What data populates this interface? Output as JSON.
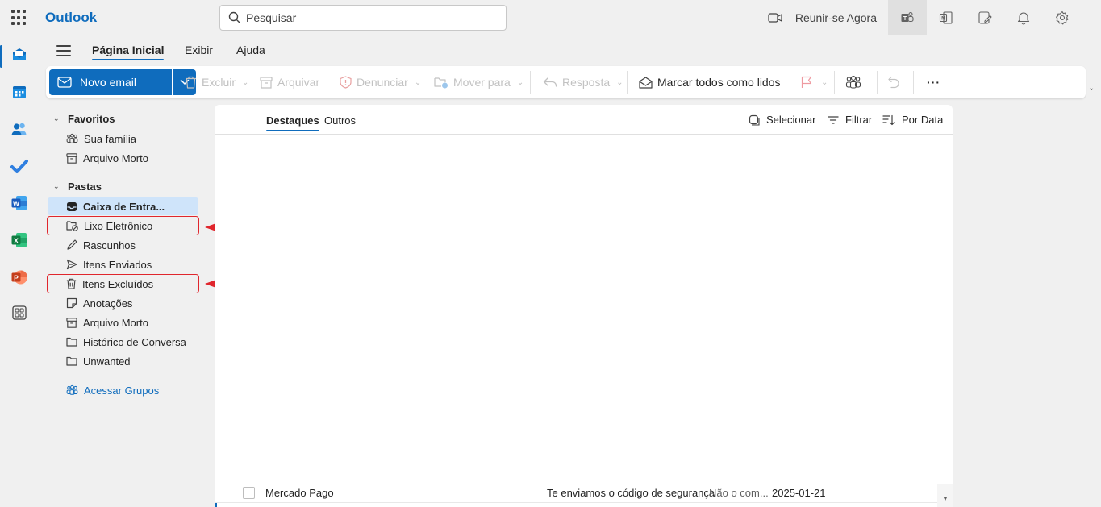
{
  "app": {
    "brand": "Outlook"
  },
  "search": {
    "placeholder": "Pesquisar"
  },
  "topbar": {
    "meet_now": "Reunir-se Agora"
  },
  "nav_tabs": [
    {
      "label": "Página Inicial",
      "selected": true
    },
    {
      "label": "Exibir",
      "selected": false
    },
    {
      "label": "Ajuda",
      "selected": false
    }
  ],
  "ribbon": {
    "new_email": "Novo email",
    "delete": "Excluir",
    "archive": "Arquivar",
    "report": "Denunciar",
    "move_to": "Mover para",
    "reply": "Resposta",
    "mark_all_read": "Marcar todos como lidos",
    "more": "···"
  },
  "folders": {
    "favorites_header": "Favoritos",
    "favorites": [
      {
        "label": "Sua família",
        "icon": "people-group-icon"
      },
      {
        "label": "Arquivo Morto",
        "icon": "archive-icon"
      }
    ],
    "folders_header": "Pastas",
    "items": [
      {
        "label": "Caixa de Entra...",
        "icon": "inbox-icon",
        "selected": true
      },
      {
        "label": "Lixo Eletrônico",
        "icon": "junk-icon",
        "highlighted": true
      },
      {
        "label": "Rascunhos",
        "icon": "drafts-icon"
      },
      {
        "label": "Itens Enviados",
        "icon": "send-icon"
      },
      {
        "label": "Itens Excluídos",
        "icon": "trash-icon",
        "highlighted": true
      },
      {
        "label": "Anotações",
        "icon": "note-icon"
      },
      {
        "label": "Arquivo Morto",
        "icon": "archive-icon"
      },
      {
        "label": "Histórico de Conversa",
        "icon": "folder-icon"
      },
      {
        "label": "Unwanted",
        "icon": "folder-icon"
      }
    ],
    "groups_link": "Acessar Grupos"
  },
  "mail_list": {
    "tabs": [
      {
        "label": "Destaques",
        "selected": true
      },
      {
        "label": "Outros",
        "selected": false
      }
    ],
    "select": "Selecionar",
    "filter": "Filtrar",
    "sort": "Por Data",
    "messages": [
      {
        "sender": "Mercado Pago",
        "subject": "Te enviamos o código de segurança",
        "preview": "Não o com...",
        "date": "2025-01-21"
      }
    ]
  },
  "colors": {
    "accent": "#0f6cbd",
    "selected_bg": "#cfe4fa",
    "annotation_red": "#e0262d"
  }
}
